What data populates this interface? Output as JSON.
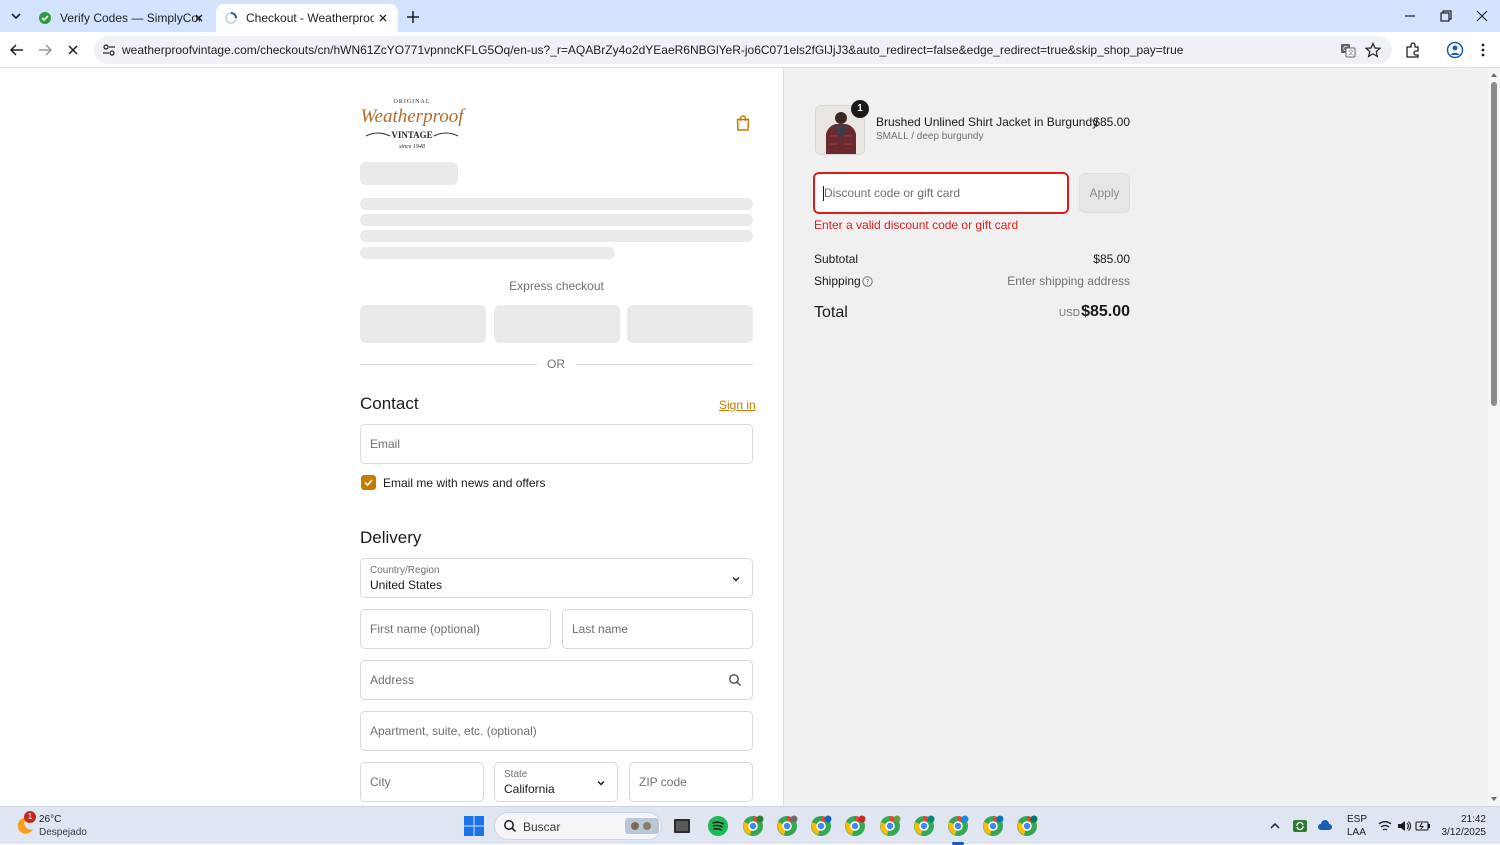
{
  "browser": {
    "tabs": [
      {
        "title": "Verify Codes — SimplyCodes",
        "favicon": "simplycodes-icon"
      },
      {
        "title": "Checkout - Weatherproof® Vintage",
        "favicon": "loading-spinner-icon",
        "active": true
      }
    ],
    "url": "weatherproofvintage.com/checkouts/cn/hWN61ZcYO771vpnncKFLG5Oq/en-us?_r=AQABrZy4o2dYEaeR6NBGlYeR-jo6C071els2fGlJjJ3&auto_redirect=false&edge_redirect=true&skip_shop_pay=true"
  },
  "logo": {
    "top_text": "ORIGINAL",
    "main_text": "Weatherproof",
    "sub_text": "VINTAGE",
    "since_text": "since 1948"
  },
  "checkout": {
    "express_label": "Express checkout",
    "or_label": "OR",
    "contact": {
      "heading": "Contact",
      "sign_in": "Sign in",
      "email_placeholder": "Email",
      "newsletter_label": "Email me with news and offers",
      "newsletter_checked": true
    },
    "delivery": {
      "heading": "Delivery",
      "country_label": "Country/Region",
      "country_value": "United States",
      "first_name_placeholder": "First name (optional)",
      "last_name_placeholder": "Last name",
      "address_placeholder": "Address",
      "apartment_placeholder": "Apartment, suite, etc. (optional)",
      "city_placeholder": "City",
      "state_label": "State",
      "state_value": "California",
      "zip_placeholder": "ZIP code"
    }
  },
  "summary": {
    "item": {
      "name": "Brushed Unlined Shirt Jacket in Burgundy",
      "variant": "SMALL / deep burgundy",
      "price": "$85.00",
      "quantity": "1"
    },
    "discount_placeholder": "Discount code or gift card",
    "apply_label": "Apply",
    "discount_error": "Enter a valid discount code or gift card",
    "subtotal_label": "Subtotal",
    "subtotal_value": "$85.00",
    "shipping_label": "Shipping",
    "shipping_value": "Enter shipping address",
    "total_label": "Total",
    "total_currency": "USD",
    "total_value": "$85.00"
  },
  "taskbar": {
    "weather_temp": "26°C",
    "weather_desc": "Despejado",
    "weather_badge": "1",
    "search_label": "Buscar",
    "lang_top": "ESP",
    "lang_bottom": "LAA",
    "time": "21:42",
    "date": "3/12/2025"
  },
  "colors": {
    "accent": "#c67a00",
    "error": "#dd1d1d",
    "chrome_tab_bar": "#d3e3fd"
  }
}
